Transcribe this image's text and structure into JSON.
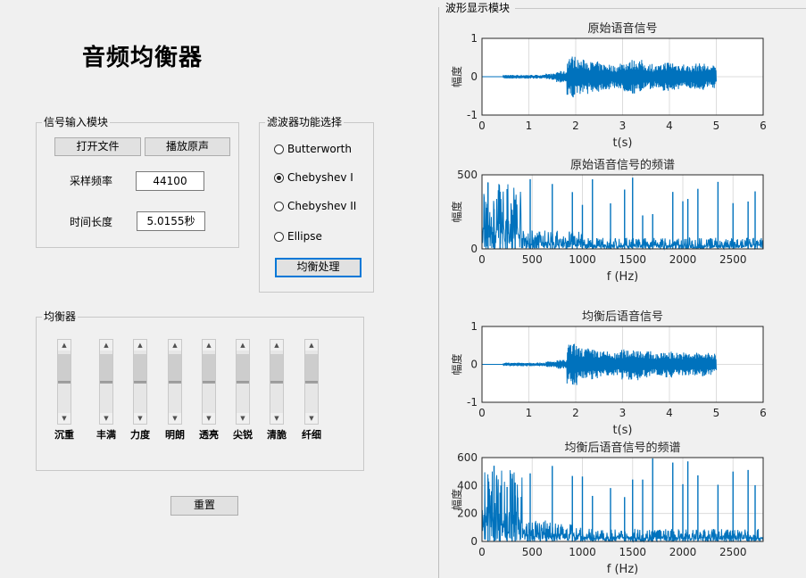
{
  "title": "音频均衡器",
  "input_panel": {
    "title": "信号输入模块",
    "open_file_button": "打开文件",
    "play_button": "播放原声",
    "sample_rate_label": "采样频率",
    "sample_rate_value": "44100",
    "duration_label": "时间长度",
    "duration_value": "5.0155秒"
  },
  "filter_panel": {
    "title": "滤波器功能选择",
    "options": [
      "Butterworth",
      "Chebyshev I",
      "Chebyshev II",
      "Ellipse"
    ],
    "selected": "Chebyshev I",
    "process_button": "均衡处理"
  },
  "eq_panel": {
    "title": "均衡器",
    "bands": [
      "沉重",
      "丰满",
      "力度",
      "明朗",
      "透亮",
      "尖锐",
      "清脆",
      "纤细"
    ]
  },
  "reset_button": "重置",
  "waveform_panel": {
    "title": "波形显示模块"
  },
  "colors": {
    "signal": "#0072bd",
    "grid": "#dcdcdc"
  },
  "chart_data": [
    {
      "type": "line",
      "title": "原始语音信号",
      "xlabel": "t(s)",
      "ylabel": "幅度",
      "xlim": [
        0,
        6
      ],
      "ylim": [
        -1,
        1
      ],
      "xticks": [
        "0",
        "1",
        "2",
        "3",
        "4",
        "5",
        "6"
      ],
      "yticks": [
        "-1",
        "0",
        "1"
      ],
      "series": [
        {
          "x_range": [
            0.45,
            5.0
          ],
          "envelope": [
            0.05,
            0.05,
            0.05,
            0.05,
            0.08,
            0.15,
            0.55,
            0.45,
            0.4,
            0.35,
            0.3,
            0.4,
            0.45,
            0.35,
            0.3,
            0.4,
            0.35,
            0.3,
            0.35,
            0.3
          ]
        }
      ]
    },
    {
      "type": "line",
      "title": "原始语音信号的频谱",
      "xlabel": "f (Hz)",
      "ylabel": "幅度",
      "xlim": [
        0,
        2800
      ],
      "ylim": [
        0,
        500
      ],
      "xticks": [
        "0",
        "500",
        "1000",
        "1500",
        "2000",
        "2500"
      ],
      "yticks": [
        "0",
        "500"
      ],
      "series": [
        {
          "peaks_hz": [
            60,
            120,
            180,
            250,
            300,
            330,
            480,
            700,
            900,
            1000,
            1100,
            1280,
            1420,
            1500,
            1600,
            1700,
            1900,
            2000,
            2050,
            2150,
            2350,
            2500,
            2650,
            2720
          ]
        }
      ]
    },
    {
      "type": "line",
      "title": "均衡后语音信号",
      "xlabel": "t(s)",
      "ylabel": "幅度",
      "xlim": [
        0,
        6
      ],
      "ylim": [
        -1,
        1
      ],
      "xticks": [
        "0",
        "1",
        "2",
        "3",
        "4",
        "5",
        "6"
      ],
      "yticks": [
        "-1",
        "0",
        "1"
      ],
      "series": [
        {
          "x_range": [
            0.45,
            5.0
          ],
          "envelope": [
            0.05,
            0.05,
            0.05,
            0.05,
            0.08,
            0.12,
            0.55,
            0.45,
            0.4,
            0.35,
            0.3,
            0.4,
            0.42,
            0.35,
            0.3,
            0.35,
            0.32,
            0.3,
            0.32,
            0.3
          ]
        }
      ]
    },
    {
      "type": "line",
      "title": "均衡后语音信号的频谱",
      "xlabel": "f (Hz)",
      "ylabel": "幅度",
      "xlim": [
        0,
        2800
      ],
      "ylim": [
        0,
        600
      ],
      "xticks": [
        "0",
        "500",
        "1000",
        "1500",
        "2000",
        "2500"
      ],
      "yticks": [
        "0",
        "200",
        "400",
        "600"
      ],
      "series": [
        {
          "peaks_hz": [
            60,
            120,
            180,
            250,
            300,
            330,
            480,
            700,
            900,
            1000,
            1100,
            1280,
            1420,
            1500,
            1600,
            1700,
            1900,
            2000,
            2050,
            2150,
            2350,
            2500,
            2650,
            2720
          ]
        }
      ]
    }
  ]
}
